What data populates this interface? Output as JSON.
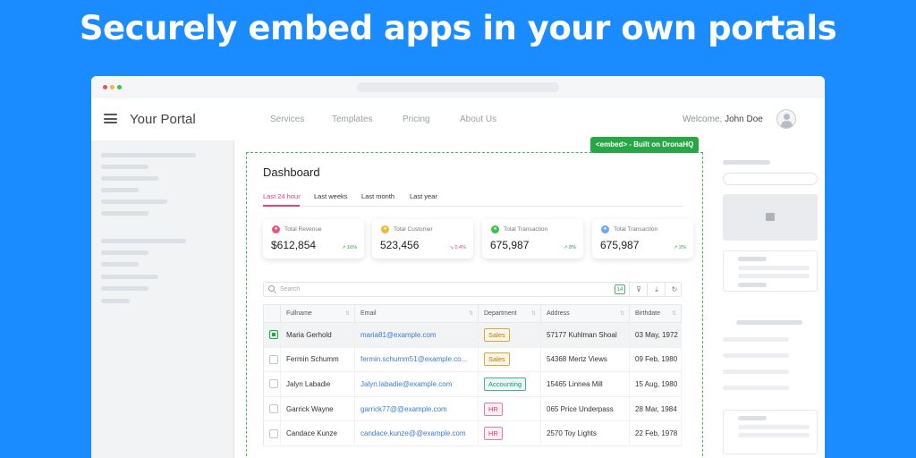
{
  "headline": "Securely embed apps in your own portals",
  "portal": {
    "brand": "Your Portal",
    "nav": [
      "Services",
      "Templates",
      "Pricing",
      "About Us"
    ],
    "welcome_prefix": "Welcome,",
    "user_name": "John Doe"
  },
  "embed_badge": "<embed> - Built on DronaHQ",
  "dashboard": {
    "title": "Dashboard",
    "tabs": [
      "Last 24 hour",
      "Last weeks",
      "Last month",
      "Last year"
    ],
    "active_tab": 0,
    "stats": [
      {
        "label": "Total Revenue",
        "value": "$612,854",
        "change": "16%",
        "trend": "up",
        "icon_color": "#f0527a"
      },
      {
        "label": "Total Customer",
        "value": "523,456",
        "change": "0.4%",
        "trend": "down",
        "icon_color": "#f5b82e"
      },
      {
        "label": "Total Transaction",
        "value": "675,987",
        "change": "8%",
        "trend": "up",
        "icon_color": "#3bc24a"
      },
      {
        "label": "Total Transaction",
        "value": "675,987",
        "change": "2%",
        "trend": "up",
        "icon_color": "#6aa8ff"
      }
    ],
    "search_placeholder": "Search",
    "row_count": "14",
    "columns": [
      "Fullname",
      "Email",
      "Department",
      "Address",
      "Birthdate"
    ],
    "rows": [
      {
        "name": "Maria Gerhold",
        "email": "maria81@example.com",
        "dept": "Sales",
        "address": "57177 Kuhlman Shoal",
        "birthdate": "03 May, 1972",
        "selected": true
      },
      {
        "name": "Fermin Schumm",
        "email": "fermin.schumm51@example.co...",
        "dept": "Sales",
        "address": "54368 Mertz Views",
        "birthdate": "09 Feb, 1980",
        "selected": false
      },
      {
        "name": "Jalyn Labadie",
        "email": "Jalyn.labadie@example.com",
        "dept": "Accounting",
        "address": "15465 Linnea Mill",
        "birthdate": "15 Aug, 1980",
        "selected": false
      },
      {
        "name": "Garrick Wayne",
        "email": "garrick77@@example.com",
        "dept": "HR",
        "address": "065 Price Underpass",
        "birthdate": "28 Mar, 1984",
        "selected": false
      },
      {
        "name": "Candace Kunze",
        "email": "candace.kunze@@example.com",
        "dept": "HR",
        "address": "2570 Toy Lights",
        "birthdate": "22 Feb, 1978",
        "selected": false
      }
    ]
  },
  "colors": {
    "background": "#1a8cff",
    "accent": "#e0457b",
    "embed_green": "#27a745"
  }
}
